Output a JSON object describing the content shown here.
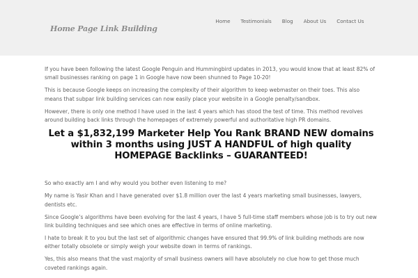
{
  "header": {
    "logo": "Home Page Link Building",
    "nav": [
      {
        "label": "Home"
      },
      {
        "label": "Testimonials"
      },
      {
        "label": "Blog"
      },
      {
        "label": "About Us"
      },
      {
        "label": "Contact Us"
      }
    ]
  },
  "main": {
    "intro": [
      "If you have been following the latest Google Penguin and Hummingbird updates in 2013, you would know that at least 82% of small businesses ranking on page 1 in Google have now been shunned to Page 10-20!",
      "This is because Google keeps on increasing the complexity of their algorithm to keep webmaster on their toes. This also means that subpar link building services can now easily place your website in a Google penalty/sandbox.",
      "However, there is only one method I have used in the last 4 years which has stood the test of time. This method revolves around building back links through the homepages of extremely powerful and authoritative high PR domains."
    ],
    "headline": [
      "Let a $1,832,199 Marketer Help You Rank BRAND NEW domains",
      "within 3 months using JUST A HANDFUL of high quality",
      "HOMEPAGE Backlinks – GUARANTEED!"
    ],
    "body": [
      "So who exactly am I and why would you bother even listening to me?",
      "My name is Yasir Khan and I have generated over $1.8 million over the last 4 years marketing small businesses, lawyers, dentists etc.",
      "Since Google’s algorithms have been evolving for the last 4 years, I have 5 full-time staff members whose job is to try out new link building techniques and see which ones are effective in terms of online marketing.",
      "I hate to break it to you but the last set of algorithmic changes have ensured that 99.9% of link building methods are now either totally obsolete or simply weigh your website down in terms of rankings.",
      "Yes, this also means that the vast majority of small business owners will have absolutely no clue how to get those much coveted rankings again."
    ]
  }
}
